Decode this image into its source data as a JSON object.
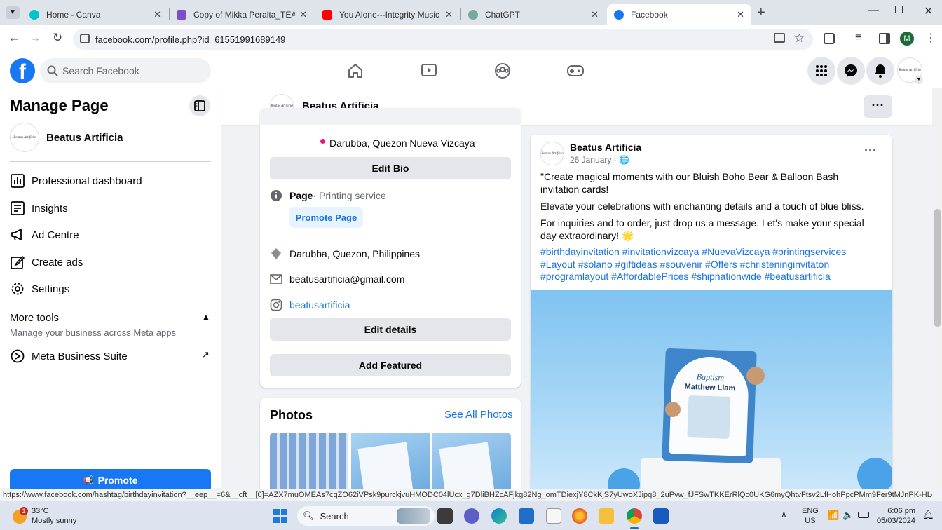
{
  "browser": {
    "tabs": [
      {
        "title": "Home - Canva",
        "color": "#00c4cc"
      },
      {
        "title": "Copy of Mikka Peralta_TEA Inte",
        "color": "#7b4fc9"
      },
      {
        "title": "You Alone---Integrity Music wit",
        "color": "#ff0000"
      },
      {
        "title": "ChatGPT",
        "color": "#74aa9c"
      },
      {
        "title": "Facebook",
        "color": "#1877f2"
      }
    ],
    "url": "facebook.com/profile.php?id=61551991689149",
    "profile_initial": "M"
  },
  "fb": {
    "logo": "f",
    "search_placeholder": "Search Facebook"
  },
  "sidebar": {
    "title": "Manage Page",
    "page_name": "Beatus Artificia",
    "items": [
      {
        "label": "Professional dashboard",
        "icon": "dashboard-icon"
      },
      {
        "label": "Insights",
        "icon": "insights-icon"
      },
      {
        "label": "Ad Centre",
        "icon": "megaphone-icon"
      },
      {
        "label": "Create ads",
        "icon": "pencil-icon"
      },
      {
        "label": "Settings",
        "icon": "gear-icon"
      }
    ],
    "more_tools": "More tools",
    "more_tools_sub": "Manage your business across Meta apps",
    "meta_suite": "Meta Business Suite",
    "promote": "Promote"
  },
  "profile_strip": {
    "name": "Beatus Artificia",
    "more": "···"
  },
  "intro": {
    "heading": "Intro",
    "location_line": "Darubba, Quezon Nueva Vizcaya",
    "edit_bio": "Edit Bio",
    "page_label": "Page",
    "page_category": " · Printing service",
    "promote_page": "Promote Page",
    "address": "Darubba, Quezon, Philippines",
    "email": "beatusartificia@gmail.com",
    "instagram": "beatusartificia",
    "edit_details": "Edit details",
    "add_featured": "Add Featured"
  },
  "photos": {
    "heading": "Photos",
    "see_all": "See All Photos"
  },
  "post": {
    "author": "Beatus Artificia",
    "date": "26 January · ",
    "p1": "\"Create magical moments with our Bluish Boho Bear & Balloon Bash invitation cards!",
    "p2": "Elevate your celebrations with enchanting details and a touch of blue bliss.",
    "p3": "For inquiries and to order, just drop us a message. Let's make your special day extraordinary! 🌟",
    "hashtags": "#birthdayinvitation #invitationvizcaya #NuevaVizcaya #printingservices #Layout #solano #giftideas #souvenir #Offers #christeninginvitaton #programlayout #AffordablePrices #shipnationwide #beatusartificia",
    "more": "···",
    "card_title": "Baptism",
    "card_name": "Matthew Liam"
  },
  "avatar_text": "Beatus Artificia",
  "status_url": "https://www.facebook.com/hashtag/birthdayinvitation?__eep__=6&__cft__[0]=AZX7muOMEAs7cqZO62iVPsk9purckjvuHMODC04lUcx_g7DliBHZcAFjkg82Ng_omTDiexjY8CkKjS7yUwoXJipq8_2uPvw_fJFSwTKKErRlQc0UKG6myQhtvFtsv2LfHohPpcPMm9Fer9tMJnPK-HLdLewzxpCwyXgm...",
  "taskbar": {
    "temp": "33°C",
    "weather": "Mostly sunny",
    "weather_badge": "1",
    "search": "Search",
    "lang": "ENG",
    "region": "US",
    "time": "6:06 pm",
    "date": "05/03/2024"
  }
}
